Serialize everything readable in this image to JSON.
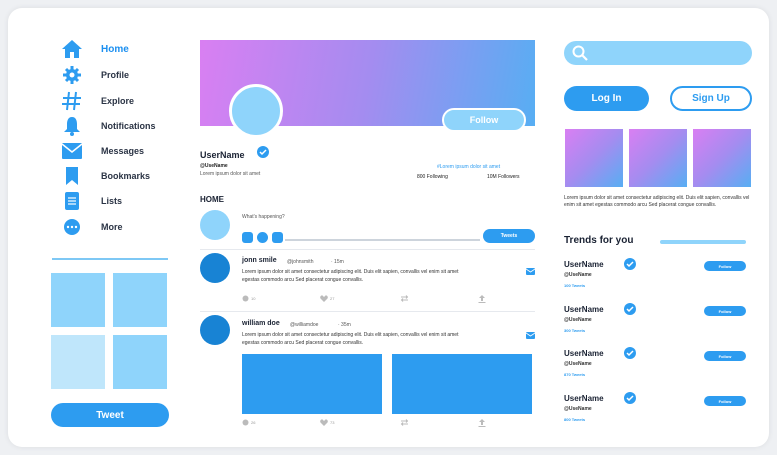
{
  "colors": {
    "accent": "#2d9cf0",
    "light_accent": "#8fd4fb",
    "dark_accent": "#1883d4",
    "tile": "#8fd4fb",
    "tile_light": "#bfe6fb"
  },
  "nav": {
    "items": [
      {
        "label": "Home",
        "icon": "home-icon",
        "active": true
      },
      {
        "label": "Profile",
        "icon": "gear-icon"
      },
      {
        "label": "Explore",
        "icon": "hashtag-icon"
      },
      {
        "label": "Notifications",
        "icon": "bell-icon"
      },
      {
        "label": "Messages",
        "icon": "mail-icon"
      },
      {
        "label": "Bookmarks",
        "icon": "bookmark-icon"
      },
      {
        "label": "Lists",
        "icon": "list-icon"
      },
      {
        "label": "More",
        "icon": "more-icon"
      }
    ],
    "tweet_label": "Tweet"
  },
  "profile": {
    "follow_label": "Follow",
    "username": "UserName",
    "handle": "@UseName",
    "bio": "Lorem ipsum dolor sit amet",
    "link": "#Lorem ipsum dolor sit amet",
    "following": "800 Following",
    "followers": "10M Followers"
  },
  "feed": {
    "section_label": "HOME",
    "compose_placeholder": "What's happening?",
    "tweets_label": "Tweets",
    "posts": [
      {
        "name": "jonn smile",
        "handle": "@johnsmith",
        "time": "· 15m",
        "text": "Lorem ipsum dolor sit amet consectetur adipiscing elit. Duis elit sapien, convallis vel enim sit amet egestas commodo arcu Sed placerat congue convallis.",
        "replies": "10",
        "likes": "27"
      },
      {
        "name": "william doe",
        "handle": "@williamdoe",
        "time": "· 35m",
        "text": "Lorem ipsum dolor sit amet consectetur adipiscing elit. Duis elit sapien, convallis vel enim sit amet egestas commodo arcu Sed placerat congue convallis.",
        "replies": "26",
        "likes": "73"
      }
    ]
  },
  "right": {
    "login_label": "Log In",
    "signup_label": "Sign Up",
    "description": "Lorem ipsum dolor sit amet consectetur adipiscing elit. Duis elit sapien, convallis vel enim sit amet egestas commodo arcu Sed placerat congue convallis.",
    "trends_title": "Trends for you",
    "trends": [
      {
        "name": "UserName",
        "handle": "@UseName",
        "count": "100 Tweets",
        "follow": "Follow"
      },
      {
        "name": "UserName",
        "handle": "@UseName",
        "count": "300 Tweets",
        "follow": "Follow"
      },
      {
        "name": "UserName",
        "handle": "@UseName",
        "count": "870 Tweets",
        "follow": "Follow"
      },
      {
        "name": "UserName",
        "handle": "@UseName",
        "count": "800 Tweets",
        "follow": "Follow"
      }
    ]
  }
}
